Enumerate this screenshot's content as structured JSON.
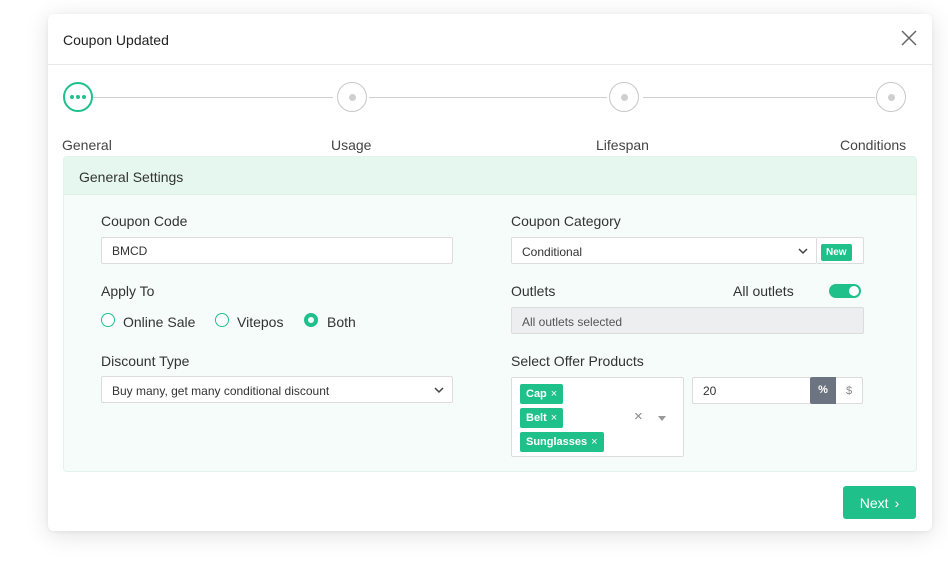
{
  "modal": {
    "title": "Coupon Updated"
  },
  "stepper": {
    "steps": [
      {
        "label": "General",
        "state": "active"
      },
      {
        "label": "Usage",
        "state": "inactive"
      },
      {
        "label": "Lifespan",
        "state": "inactive"
      },
      {
        "label": "Conditions",
        "state": "inactive"
      }
    ]
  },
  "panel": {
    "title": "General Settings"
  },
  "coupon_code": {
    "label": "Coupon Code",
    "value": "BMCD"
  },
  "coupon_category": {
    "label": "Coupon Category",
    "value": "Conditional",
    "badge": "New"
  },
  "apply_to": {
    "label": "Apply To",
    "options": [
      "Online Sale",
      "Vitepos",
      "Both"
    ],
    "selected": "Both"
  },
  "outlets": {
    "label": "Outlets",
    "toggle_label": "All outlets",
    "toggle_on": true,
    "value": "All outlets selected"
  },
  "discount_type": {
    "label": "Discount Type",
    "value": "Buy many, get many conditional discount"
  },
  "offer_products": {
    "label": "Select Offer Products",
    "tags": [
      "Cap",
      "Belt",
      "Sunglasses"
    ],
    "tag_remove": "×",
    "clear": "×"
  },
  "discount_value": {
    "value": "20",
    "units": [
      "%",
      "$"
    ],
    "selected_unit": "%"
  },
  "footer": {
    "next_label": "Next",
    "next_arrow": "›"
  },
  "colors": {
    "accent": "#20c08a",
    "panel_bg": "#f6fcfa",
    "panel_header": "#e6f7f0",
    "unit_active": "#6b7480"
  }
}
